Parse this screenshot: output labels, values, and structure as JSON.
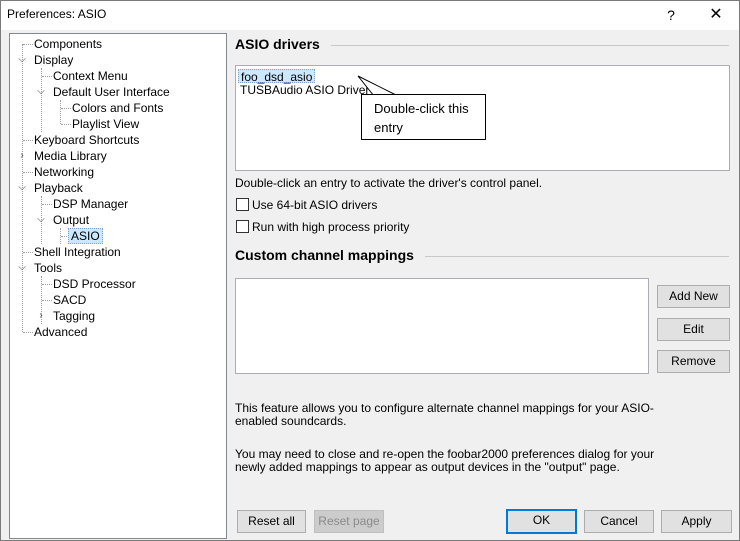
{
  "window": {
    "title": "Preferences: ASIO",
    "help_glyph": "?",
    "close_glyph": "✕"
  },
  "tree": {
    "items": [
      {
        "label": "Components"
      },
      {
        "label": "Display"
      },
      {
        "label": "Context Menu"
      },
      {
        "label": "Default User Interface"
      },
      {
        "label": "Colors and Fonts"
      },
      {
        "label": "Playlist View"
      },
      {
        "label": "Keyboard Shortcuts"
      },
      {
        "label": "Media Library"
      },
      {
        "label": "Networking"
      },
      {
        "label": "Playback"
      },
      {
        "label": "DSP Manager"
      },
      {
        "label": "Output"
      },
      {
        "label": "ASIO"
      },
      {
        "label": "Shell Integration"
      },
      {
        "label": "Tools"
      },
      {
        "label": "DSD Processor"
      },
      {
        "label": "SACD"
      },
      {
        "label": "Tagging"
      },
      {
        "label": "Advanced"
      }
    ]
  },
  "asio": {
    "title": "ASIO drivers",
    "drivers": [
      "foo_dsd_asio",
      "TUSBAudio ASIO Driver"
    ],
    "callout": "Double-click this entry",
    "hint": "Double-click an entry to activate the driver's control panel.",
    "use64": "Use 64-bit ASIO drivers",
    "highprio": "Run with high process priority"
  },
  "mappings": {
    "title": "Custom channel mappings",
    "add_new": "Add New",
    "edit": "Edit",
    "remove": "Remove",
    "info1": "This feature allows you to configure alternate channel mappings for your ASIO-enabled soundcards.",
    "info2": "You may need to close and re-open the foobar2000 preferences dialog for your newly added mappings to appear as output devices in the \"output\" page."
  },
  "footer": {
    "reset_all": "Reset all",
    "reset_page": "Reset page",
    "ok": "OK",
    "cancel": "Cancel",
    "apply": "Apply"
  }
}
